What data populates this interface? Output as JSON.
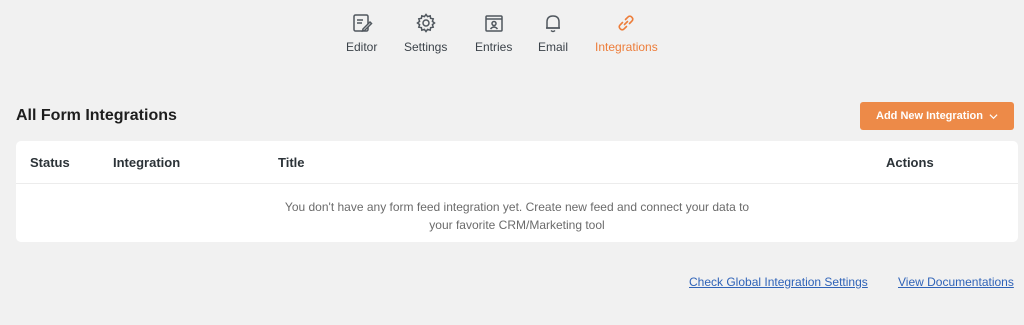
{
  "tabs": [
    {
      "label": "Editor",
      "icon": "editor-icon"
    },
    {
      "label": "Settings",
      "icon": "gear-icon"
    },
    {
      "label": "Entries",
      "icon": "entries-icon"
    },
    {
      "label": "Email",
      "icon": "bell-icon"
    },
    {
      "label": "Integrations",
      "icon": "link-icon",
      "active": true
    }
  ],
  "heading": "All Form Integrations",
  "add_button": {
    "label": "Add New Integration",
    "icon": "chevron-down-icon"
  },
  "table": {
    "columns": [
      "Status",
      "Integration",
      "Title",
      "Actions"
    ],
    "empty_line1": "You don't have any form feed integration yet. Create new feed and connect your data to",
    "empty_line2": "your favorite CRM/Marketing tool"
  },
  "footer": {
    "global_settings_link": "Check Global Integration Settings",
    "docs_link": "View Documentations"
  },
  "colors": {
    "accent": "#ed7d3a",
    "button": "#ed8a48",
    "link": "#2f63b8",
    "background": "#f1f1f1"
  }
}
